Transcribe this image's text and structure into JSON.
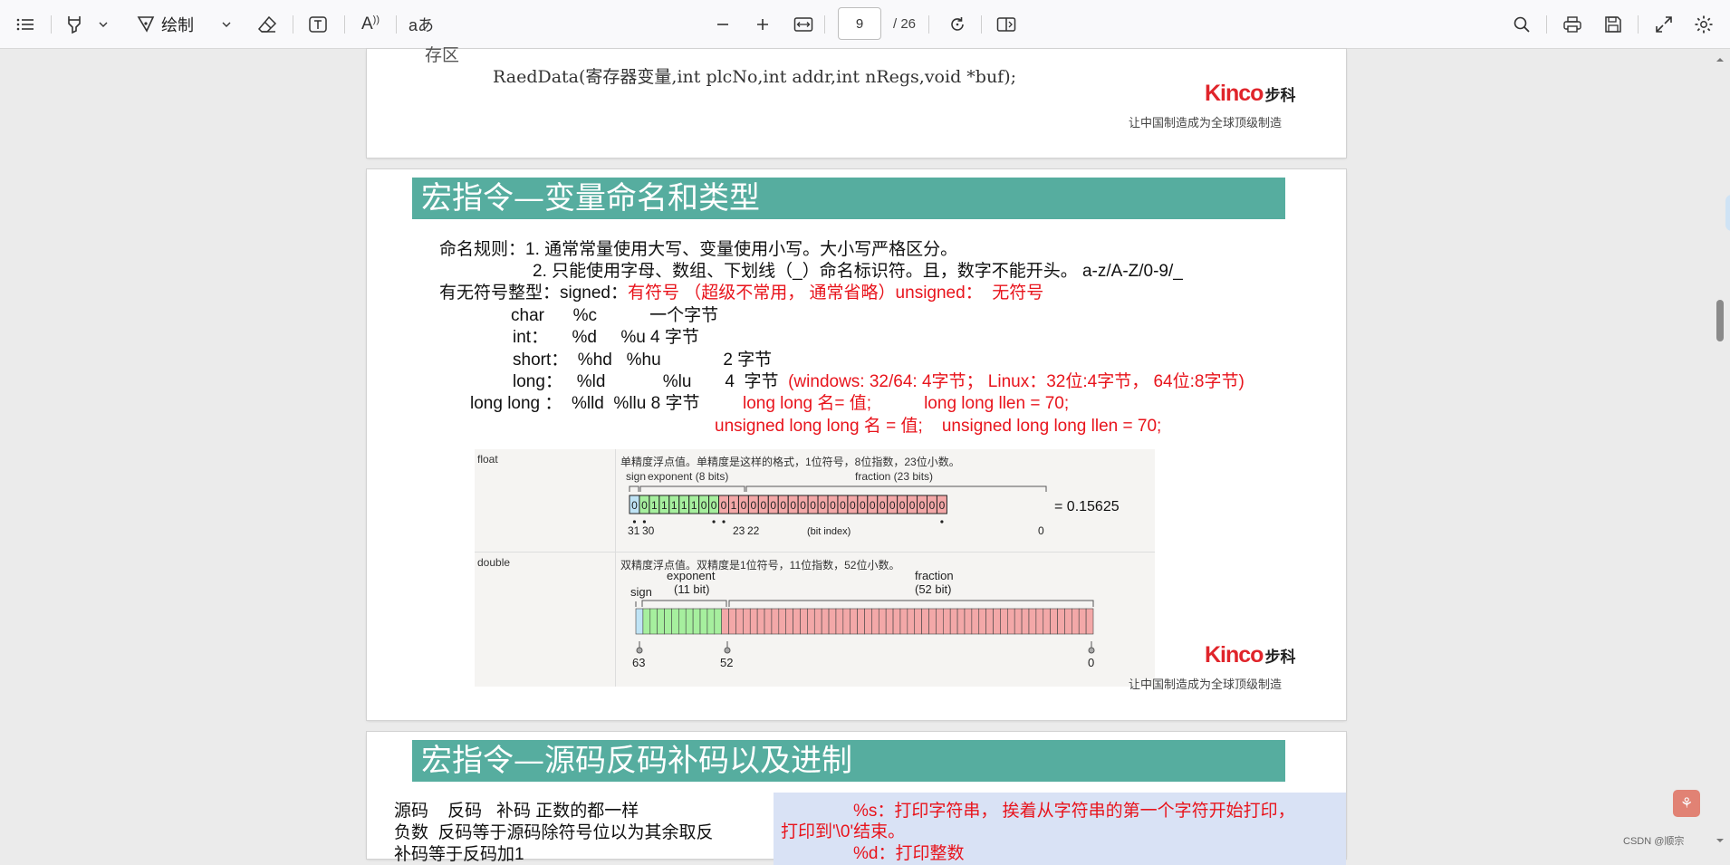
{
  "toolbar": {
    "draw_label": "绘制",
    "page_current": "9",
    "page_total": "/ 26",
    "read_aloud_glyph": "A",
    "translate_glyph": "aあ"
  },
  "page_top": {
    "cut_text": "存区",
    "code_line": "RaedData(寄存器变量,int plcNo,int addr,int nRegs,void *buf);",
    "kinco_logo": "Kinco",
    "kinco_cn": "步科",
    "slogan": "让中国制造成为全球顶级制造"
  },
  "page_mid": {
    "banner": "宏指令—变量命名和类型",
    "rule_line1": "命名规则：1. 通常常量使用大写、变量使用小写。大小写严格区分。",
    "rule_line2": "2. 只能使用字母、数组、下划线（_）命名标识符。且，数字不能开头。 a-z/A-Z/0-9/_",
    "signed_black": "有无符号整型：signed：",
    "signed_red": "有符号 （超级不常用， 通常省略）unsigned：  无符号",
    "char_line": "char      %c           一个字节",
    "int_line": "int：     %d     %u 4 字节",
    "short_line": "short：  %hd   %hu             2 字节",
    "long_black": "long：   %ld            %lu       4  字节",
    "long_red": "(windows: 32/64: 4字节； Linux：32位:4字节， 64位:8字节)",
    "longlong_black": "long long ：  %lld  %llu 8 字节",
    "longlong_red": "long long 名= 值;           long long llen = 70;",
    "unsigned_red": "unsigned long long 名 = 值;    unsigned long long llen = 70;",
    "kinco_logo": "Kinco",
    "kinco_cn": "步科",
    "slogan": "让中国制造成为全球顶级制造",
    "figure": {
      "float_label": "float",
      "float_desc": "单精度浮点值。单精度是这样的格式，1位符号，8位指数，23位小数。",
      "float_sign": "sign",
      "float_exp": "exponent (8 bits)",
      "float_frac": "fraction (23 bits)",
      "float_bits": "00111110001000000000000000000000",
      "float_value": "= 0.15625",
      "float_idx_31": "31",
      "float_idx_30": "30",
      "float_idx_23": "23",
      "float_idx_22": "22",
      "float_idx_label": "(bit index)",
      "float_idx_0": "0",
      "double_label": "double",
      "double_desc": "双精度浮点值。双精度是1位符号，11位指数，52位小数。",
      "double_sign": "sign",
      "double_exp": "exponent",
      "double_exp_bits": "(11 bit)",
      "double_frac": "fraction",
      "double_frac_bits": "(52 bit)",
      "double_idx_63": "63",
      "double_idx_52": "52",
      "double_idx_0": "0"
    }
  },
  "page_bottom": {
    "banner": "宏指令—源码反码补码以及进制",
    "left_line1": "源码    反码   补码 正数的都一样",
    "left_line2": "负数  反码等于源码除符号位以为其余取反",
    "left_line3": "补码等于反码加1",
    "right_line1": "%s：打印字符串， 挨着从字符串的第一个字符开始打印，",
    "right_line2": "打印到'\\0'结束。",
    "right_line3": "%d：打印整数"
  },
  "watermark": "CSDN @顺宗",
  "colors": {
    "banner": "#56ad9f",
    "red_text": "#e8141c",
    "kinco_red": "#e0252b",
    "float_sign": "#bfe3f5",
    "float_exp": "#a6ef9e",
    "float_frac": "#f3a8a8",
    "highlight_box": "#d9e2f5"
  }
}
